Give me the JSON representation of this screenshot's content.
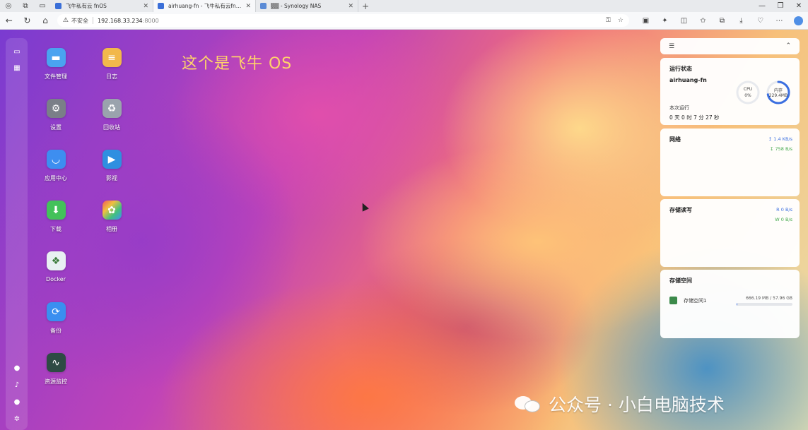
{
  "browser": {
    "tabs": [
      {
        "title": "飞牛私有云 fnOS",
        "active": false
      },
      {
        "title": "airhuang-fn - 飞牛私有云fnOS",
        "active": true
      },
      {
        "title": "▒▒ - Synology NAS",
        "active": false
      }
    ],
    "security_label": "不安全",
    "url_host": "192.168.33.234",
    "url_port": ":8000"
  },
  "desktop": {
    "headline": "这个是飞牛 OS",
    "apps": [
      {
        "label": "文件管理",
        "icon": "folder-icon",
        "color": "#4aa3f0"
      },
      {
        "label": "日志",
        "icon": "log-icon",
        "color": "#f2b84b"
      },
      {
        "label": "设置",
        "icon": "gear-icon",
        "color": "#7a7f88"
      },
      {
        "label": "回收站",
        "icon": "recycle-icon",
        "color": "#9aa3ad"
      },
      {
        "label": "应用中心",
        "icon": "store-icon",
        "color": "#3d8ef0"
      },
      {
        "label": "影视",
        "icon": "video-icon",
        "color": "#2f8fe0"
      },
      {
        "label": "下载",
        "icon": "download-icon",
        "color": "#43c15a"
      },
      {
        "label": "相册",
        "icon": "photos-icon",
        "color": "#f0a040"
      },
      {
        "label": "Docker",
        "icon": "docker-icon",
        "color": "#e8f0f2"
      },
      {
        "label": "备份",
        "icon": "backup-icon",
        "color": "#3a8ff0"
      },
      {
        "label": "资源监控",
        "icon": "monitor-icon",
        "color": "#2e4b44"
      }
    ]
  },
  "widgets": {
    "status": {
      "title": "运行状态",
      "hostname": "airhuang-fn",
      "cpu_label": "CPU",
      "cpu_value": "0%",
      "cpu_percent": 0,
      "mem_label": "内存",
      "mem_value": "229.4MB",
      "mem_fraction": 0.72,
      "uptime_label": "本次运行",
      "uptime_value": "0 天 0 时 7 分 27 秒"
    },
    "network": {
      "title": "网络",
      "up": "↥ 1.4 KB/s",
      "down": "↧ 758 B/s"
    },
    "storage_io": {
      "title": "存储读写",
      "read": "R  0 B/s",
      "write": "W  0 B/s"
    },
    "storage": {
      "title": "存储空间",
      "volume_name": "存储空间1",
      "capacity": "666.19 MB / 57.96 GB",
      "used_fraction": 0.0115
    }
  },
  "watermark": "公众号 · 小白电脑技术",
  "colors": {
    "headline": "#ffd36a",
    "accent_blue": "#3b6fe0",
    "accent_green": "#41a84a"
  }
}
